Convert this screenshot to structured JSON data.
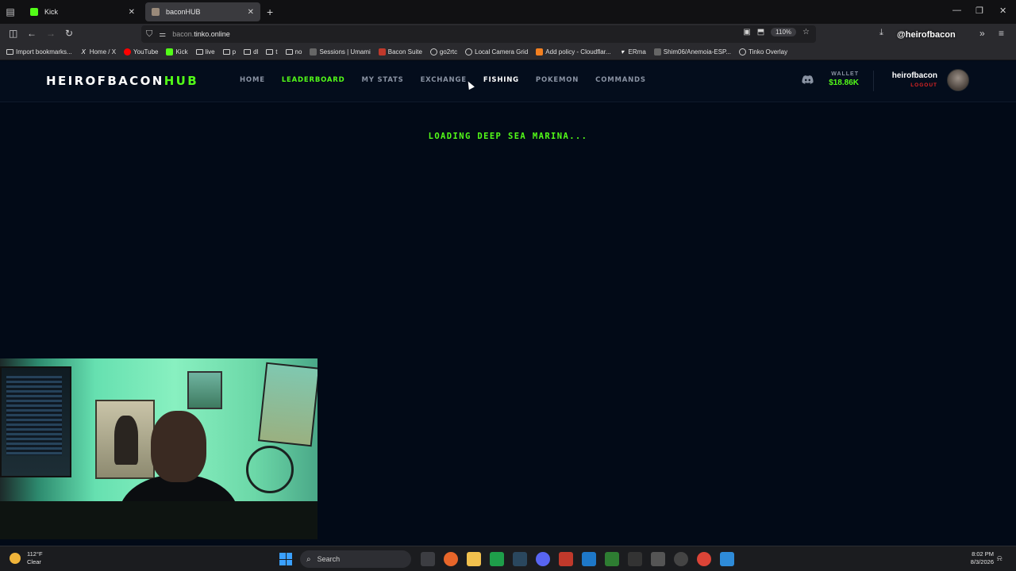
{
  "browser": {
    "tabs": [
      {
        "title": "Kick",
        "active": false,
        "favicon": "kick-icon"
      },
      {
        "title": "baconHUB",
        "active": true,
        "favicon": "bacon-icon"
      }
    ],
    "url_host_dim": "bacon.",
    "url_host": "tinko.online",
    "zoom": "110%",
    "overlay_handle": "@heirofbacon",
    "bookmarks": [
      {
        "label": "Import bookmarks...",
        "icon": "folder-icon"
      },
      {
        "label": "Home / X",
        "icon": "x-icon"
      },
      {
        "label": "YouTube",
        "icon": "youtube-icon"
      },
      {
        "label": "Kick",
        "icon": "kick-icon"
      },
      {
        "label": "live",
        "icon": "folder-icon"
      },
      {
        "label": "p",
        "icon": "folder-icon"
      },
      {
        "label": "dl",
        "icon": "folder-icon"
      },
      {
        "label": "t",
        "icon": "folder-icon"
      },
      {
        "label": "no",
        "icon": "folder-icon"
      },
      {
        "label": "Sessions | Umami",
        "icon": "umami-icon"
      },
      {
        "label": "Bacon Suite",
        "icon": "bacon-icon"
      },
      {
        "label": "go2rtc",
        "icon": "go2rtc-icon"
      },
      {
        "label": "Local Camera Grid",
        "icon": "globe-icon"
      },
      {
        "label": "Add policy - Cloudflar...",
        "icon": "cloudflare-icon"
      },
      {
        "label": "ERma",
        "icon": "erma-icon"
      },
      {
        "label": "Shim06/Anemoia-ESP...",
        "icon": "github-icon"
      },
      {
        "label": "Tinko Overlay",
        "icon": "globe-icon"
      }
    ]
  },
  "site": {
    "logo_main": "HEIROFBACON",
    "logo_accent": "HUB",
    "nav": [
      {
        "label": "HOME",
        "state": "normal"
      },
      {
        "label": "LEADERBOARD",
        "state": "active"
      },
      {
        "label": "MY STATS",
        "state": "normal"
      },
      {
        "label": "EXCHANGE",
        "state": "normal"
      },
      {
        "label": "FISHING",
        "state": "hover"
      },
      {
        "label": "POKEMON",
        "state": "normal"
      },
      {
        "label": "COMMANDS",
        "state": "normal"
      }
    ],
    "wallet_label": "WALLET",
    "wallet_value": "$18.86K",
    "username": "heirofbacon",
    "logout": "LOGOUT",
    "accent_color": "#53fc18",
    "logout_color": "#e02424"
  },
  "main": {
    "loading_text": "LOADING DEEP SEA MARINA..."
  },
  "taskbar": {
    "temperature": "112°F",
    "condition": "Clear",
    "search_placeholder": "Search",
    "time": "8:02 PM",
    "date": "8/3/2026"
  }
}
